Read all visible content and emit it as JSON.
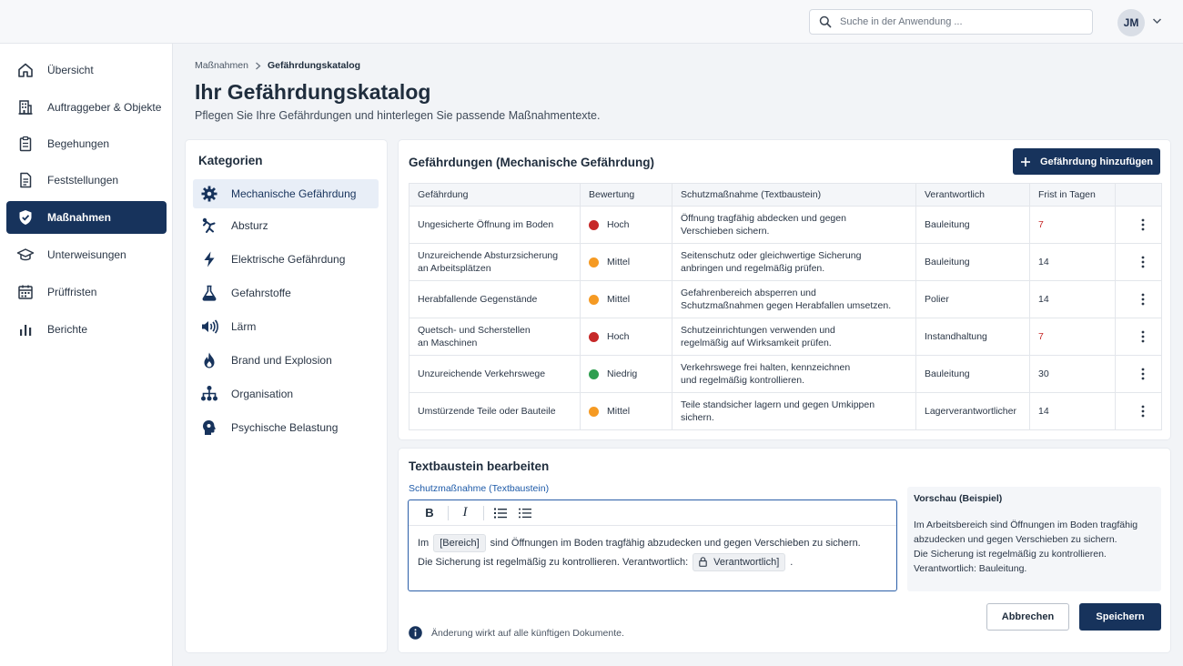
{
  "header": {
    "search_placeholder": "Suche in der Anwendung ...",
    "avatar_initials": "JM"
  },
  "sidebar": {
    "items": [
      {
        "label": "Übersicht",
        "icon": "home-icon"
      },
      {
        "label": "Auftraggeber & Objekte",
        "icon": "building-icon"
      },
      {
        "label": "Begehungen",
        "icon": "clipboard-icon"
      },
      {
        "label": "Feststellungen",
        "icon": "document-icon"
      },
      {
        "label": "Maßnahmen",
        "icon": "shield-icon",
        "active": true
      },
      {
        "label": "Unterweisungen",
        "icon": "graduation-cap-icon"
      },
      {
        "label": "Prüffristen",
        "icon": "calendar-icon"
      },
      {
        "label": "Berichte",
        "icon": "bar-chart-icon"
      }
    ]
  },
  "breadcrumb": {
    "parent": "Maßnahmen",
    "current": "Gefährdungskatalog"
  },
  "page": {
    "title": "Ihr Gefährdungskatalog",
    "subtitle": "Pflegen Sie Ihre Gefährdungen und hinterlegen Sie passende Maßnahmentexte."
  },
  "categories": {
    "title": "Kategorien",
    "items": [
      {
        "label": "Mechanische Gefährdung",
        "icon": "gear-icon",
        "active": true
      },
      {
        "label": "Absturz",
        "icon": "falling-person-icon"
      },
      {
        "label": "Elektrische Gefährdung",
        "icon": "lightning-icon"
      },
      {
        "label": "Gefahrstoffe",
        "icon": "flask-icon"
      },
      {
        "label": "Lärm",
        "icon": "sound-waves-icon"
      },
      {
        "label": "Brand und Explosion",
        "icon": "flame-icon"
      },
      {
        "label": "Organisation",
        "icon": "org-chart-icon"
      },
      {
        "label": "Psychische Belastung",
        "icon": "head-icon"
      }
    ]
  },
  "hazards": {
    "title": "Gefährdungen (Mechanische Gefährdung)",
    "add_button": "Gefährdung hinzufügen",
    "columns": [
      "Gefährdung",
      "Bewertung",
      "Schutzmaßnahme (Textbaustein)",
      "Verantwortlich",
      "Frist in Tagen"
    ],
    "rows": [
      {
        "hazard_l1": "Ungesicherte Öffnung im Boden",
        "hazard_l2": "",
        "rating": "Hoch",
        "rating_color": "#c62828",
        "measure_l1": "Öffnung tragfähig abdecken und gegen",
        "measure_l2": "Verschieben sichern.",
        "responsible": "Bauleitung",
        "deadline": "7",
        "urgent": true
      },
      {
        "hazard_l1": "Unzureichende Absturzsicherung",
        "hazard_l2": "an Arbeitsplätzen",
        "rating": "Mittel",
        "rating_color": "#f59a23",
        "measure_l1": "Seitenschutz oder gleichwertige Sicherung",
        "measure_l2": "anbringen und regelmäßig prüfen.",
        "responsible": "Bauleitung",
        "deadline": "14",
        "urgent": false
      },
      {
        "hazard_l1": "Herabfallende Gegenstände",
        "hazard_l2": "",
        "rating": "Mittel",
        "rating_color": "#f59a23",
        "measure_l1": "Gefahrenbereich absperren und",
        "measure_l2": "Schutzmaßnahmen gegen Herabfallen umsetzen.",
        "responsible": "Polier",
        "deadline": "14",
        "urgent": false
      },
      {
        "hazard_l1": "Quetsch- und Scherstellen",
        "hazard_l2": "an Maschinen",
        "rating": "Hoch",
        "rating_color": "#c62828",
        "measure_l1": "Schutzeinrichtungen verwenden und",
        "measure_l2": "regelmäßig auf Wirksamkeit prüfen.",
        "responsible": "Instandhaltung",
        "deadline": "7",
        "urgent": true
      },
      {
        "hazard_l1": "Unzureichende Verkehrswege",
        "hazard_l2": "",
        "rating": "Niedrig",
        "rating_color": "#2e9e4f",
        "measure_l1": "Verkehrswege frei halten, kennzeichnen",
        "measure_l2": "und regelmäßig kontrollieren.",
        "responsible": "Bauleitung",
        "deadline": "30",
        "urgent": false
      },
      {
        "hazard_l1": "Umstürzende Teile oder Bauteile",
        "hazard_l2": "",
        "rating": "Mittel",
        "rating_color": "#f59a23",
        "measure_l1": "Teile standsicher lagern und gegen Umkippen",
        "measure_l2": "sichern.",
        "responsible": "Lagerverantwortlicher",
        "deadline": "14",
        "urgent": false
      }
    ]
  },
  "editor": {
    "title": "Textbaustein bearbeiten",
    "field_label": "Schutzmaßnahme (Textbaustein)",
    "line1_prefix": "Im",
    "placeholder_area": "[Bereich]",
    "line1_suffix": "sind Öffnungen im Boden tragfähig abzudecken und gegen Verschieben zu sichern.",
    "line2_prefix": "Die Sicherung ist regelmäßig zu kontrollieren. Verantwortlich:",
    "placeholder_responsible": "Verantwortlich]",
    "line2_suffix": ".",
    "toolbar": {
      "bold": "B",
      "italic": "I"
    }
  },
  "preview": {
    "title": "Vorschau (Beispiel)",
    "lines": [
      "Im Arbeitsbereich sind Öffnungen im Boden tragfähig",
      "abzudecken und gegen Verschieben zu sichern.",
      "Die Sicherung ist regelmäßig zu kontrollieren.",
      "Verantwortlich: Bauleitung."
    ]
  },
  "actions": {
    "cancel": "Abbrechen",
    "save": "Speichern"
  },
  "info_text": "Änderung wirkt auf alle künftigen Dokumente.",
  "colors": {
    "primary": "#17335c",
    "accent_blue": "#2b5fa8",
    "danger": "#c62828",
    "warning": "#f59a23",
    "success": "#2e9e4f"
  }
}
